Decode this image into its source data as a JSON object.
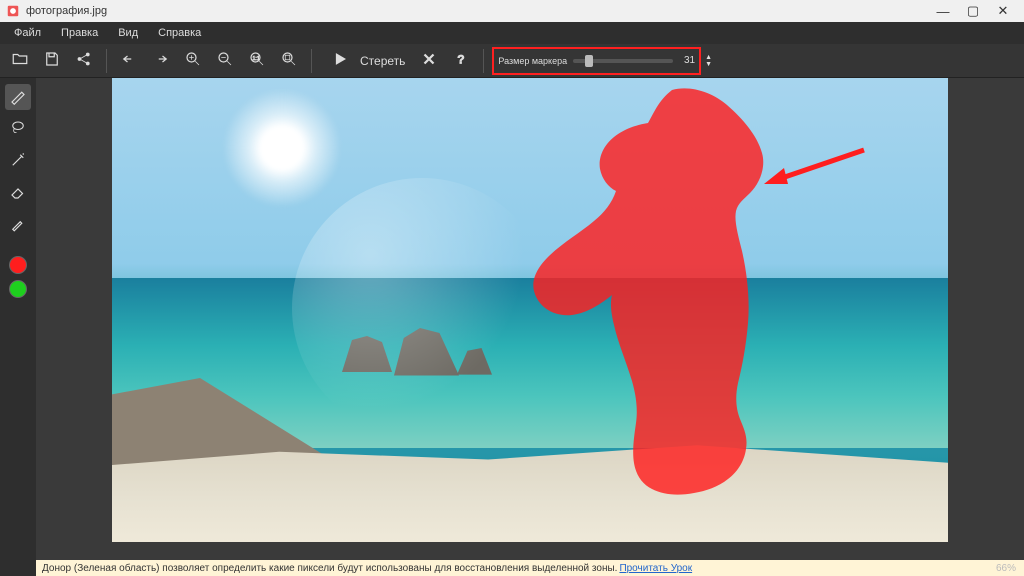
{
  "window": {
    "title": "фотография.jpg",
    "minimize": "—",
    "maximize": "▢",
    "close": "✕"
  },
  "menu": {
    "file": "Файл",
    "edit": "Правка",
    "view": "Вид",
    "help": "Справка"
  },
  "toolbar": {
    "erase_label": "Стереть",
    "marker_size_label": "Размер маркера",
    "marker_size_value": "31"
  },
  "sidebar": {
    "colors": {
      "red": "#ff1e1e",
      "green": "#1ecf1e"
    }
  },
  "hint": {
    "text": "Донор (Зеленая область) позволяет определить какие пиксели будут использованы для восстановления выделенной зоны.",
    "link": "Прочитать Урок"
  },
  "status": {
    "zoom": "66%"
  }
}
